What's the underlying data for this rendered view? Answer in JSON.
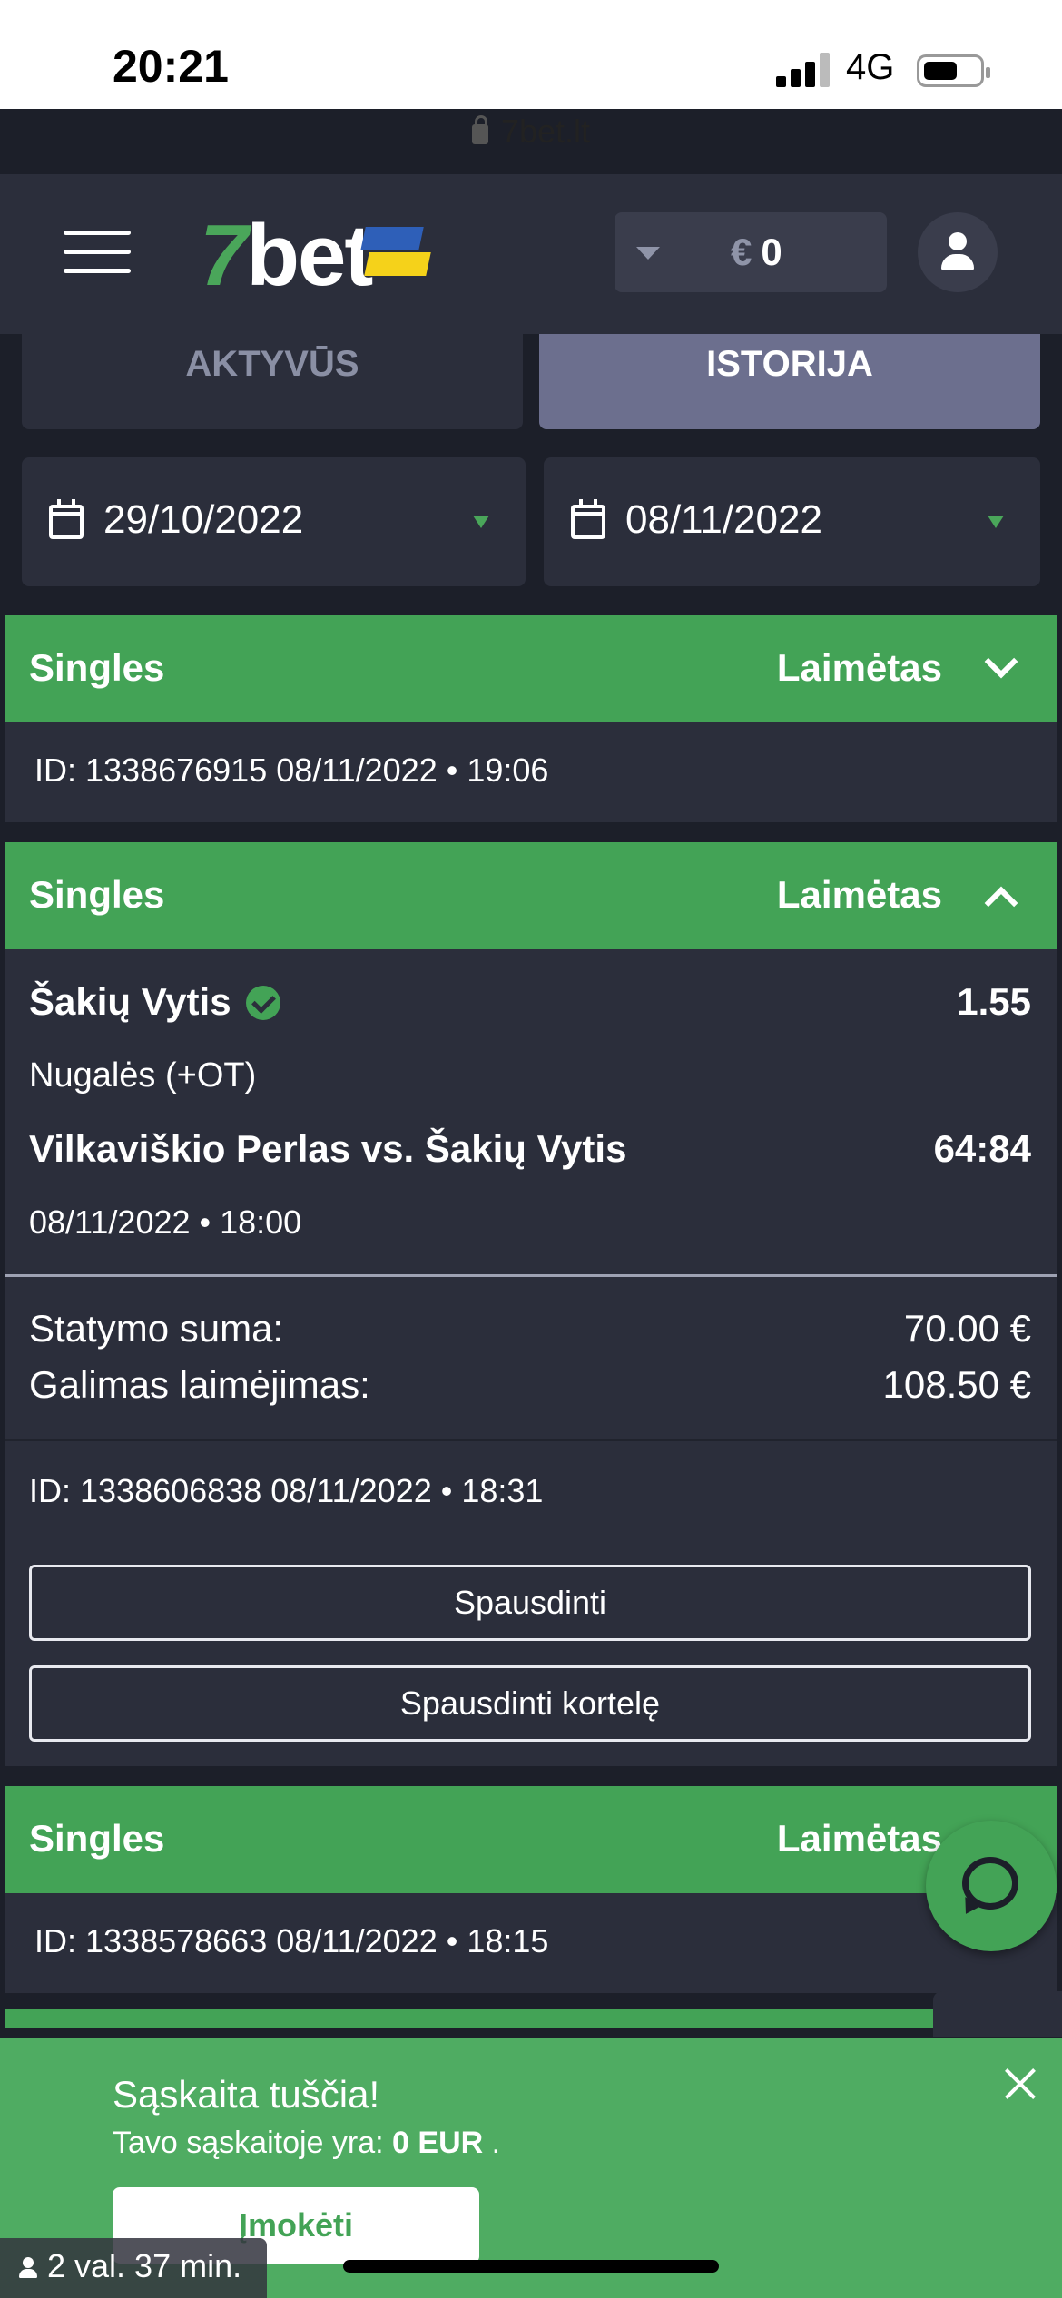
{
  "status_bar": {
    "time": "20:21",
    "network": "4G",
    "url": "7bet.lt"
  },
  "header": {
    "logo_seven": "7",
    "logo_bet": "bet",
    "currency": "€",
    "balance": "0"
  },
  "tabs": {
    "active": "AKTYVŪS",
    "history": "ISTORIJA"
  },
  "filters": {
    "date_from": "29/10/2022",
    "date_to": "08/11/2022"
  },
  "bets": [
    {
      "type": "Singles",
      "status": "Laimėtas",
      "id_line": "ID: 1338676915  08/11/2022 • 19:06"
    },
    {
      "type": "Singles",
      "status": "Laimėtas",
      "selection": "Šakių Vytis",
      "odds": "1.55",
      "market": "Nugalės (+OT)",
      "match": "Vilkaviškio Perlas vs. Šakių Vytis",
      "score": "64:84",
      "event_time": "08/11/2022 • 18:00",
      "stake_label": "Statymo suma:",
      "stake_value": "70.00 €",
      "win_label": "Galimas laimėjimas:",
      "win_value": "108.50 €",
      "id_line": "ID: 1338606838  08/11/2022 • 18:31",
      "print_label": "Spausdinti",
      "print_card_label": "Spausdinti kortelę"
    },
    {
      "type": "Singles",
      "status": "Laimėtas",
      "id_line": "ID: 1338578663  08/11/2022 • 18:15"
    }
  ],
  "banner": {
    "title": "Sąskaita tuščia!",
    "text": "Tavo sąskaitoje yra: ",
    "amount": "0 EUR",
    "suffix": " .",
    "deposit_label": "Įmokėti"
  },
  "session": {
    "label": "2 val. 37 min."
  },
  "colors": {
    "accent": "#43a356",
    "header": "#2b2e3b",
    "background": "#1c1f29"
  }
}
